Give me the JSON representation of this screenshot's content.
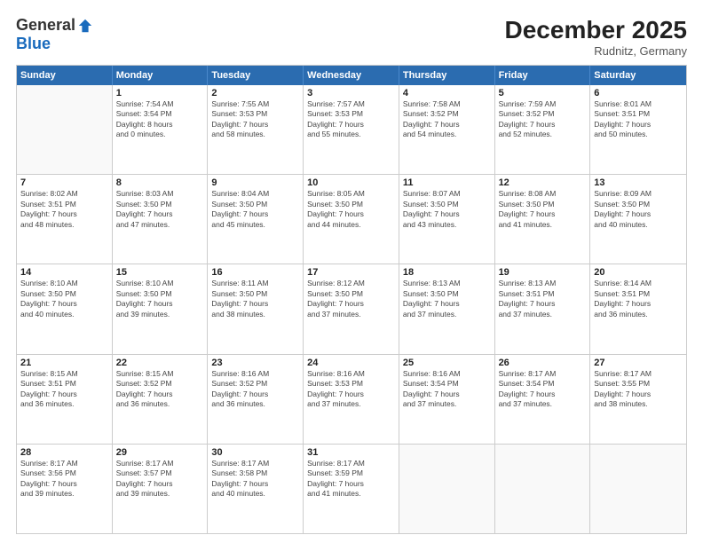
{
  "logo": {
    "general": "General",
    "blue": "Blue"
  },
  "title": "December 2025",
  "subtitle": "Rudnitz, Germany",
  "header_days": [
    "Sunday",
    "Monday",
    "Tuesday",
    "Wednesday",
    "Thursday",
    "Friday",
    "Saturday"
  ],
  "weeks": [
    [
      {
        "day": "",
        "info": ""
      },
      {
        "day": "1",
        "info": "Sunrise: 7:54 AM\nSunset: 3:54 PM\nDaylight: 8 hours\nand 0 minutes."
      },
      {
        "day": "2",
        "info": "Sunrise: 7:55 AM\nSunset: 3:53 PM\nDaylight: 7 hours\nand 58 minutes."
      },
      {
        "day": "3",
        "info": "Sunrise: 7:57 AM\nSunset: 3:53 PM\nDaylight: 7 hours\nand 55 minutes."
      },
      {
        "day": "4",
        "info": "Sunrise: 7:58 AM\nSunset: 3:52 PM\nDaylight: 7 hours\nand 54 minutes."
      },
      {
        "day": "5",
        "info": "Sunrise: 7:59 AM\nSunset: 3:52 PM\nDaylight: 7 hours\nand 52 minutes."
      },
      {
        "day": "6",
        "info": "Sunrise: 8:01 AM\nSunset: 3:51 PM\nDaylight: 7 hours\nand 50 minutes."
      }
    ],
    [
      {
        "day": "7",
        "info": "Sunrise: 8:02 AM\nSunset: 3:51 PM\nDaylight: 7 hours\nand 48 minutes."
      },
      {
        "day": "8",
        "info": "Sunrise: 8:03 AM\nSunset: 3:50 PM\nDaylight: 7 hours\nand 47 minutes."
      },
      {
        "day": "9",
        "info": "Sunrise: 8:04 AM\nSunset: 3:50 PM\nDaylight: 7 hours\nand 45 minutes."
      },
      {
        "day": "10",
        "info": "Sunrise: 8:05 AM\nSunset: 3:50 PM\nDaylight: 7 hours\nand 44 minutes."
      },
      {
        "day": "11",
        "info": "Sunrise: 8:07 AM\nSunset: 3:50 PM\nDaylight: 7 hours\nand 43 minutes."
      },
      {
        "day": "12",
        "info": "Sunrise: 8:08 AM\nSunset: 3:50 PM\nDaylight: 7 hours\nand 41 minutes."
      },
      {
        "day": "13",
        "info": "Sunrise: 8:09 AM\nSunset: 3:50 PM\nDaylight: 7 hours\nand 40 minutes."
      }
    ],
    [
      {
        "day": "14",
        "info": "Sunrise: 8:10 AM\nSunset: 3:50 PM\nDaylight: 7 hours\nand 40 minutes."
      },
      {
        "day": "15",
        "info": "Sunrise: 8:10 AM\nSunset: 3:50 PM\nDaylight: 7 hours\nand 39 minutes."
      },
      {
        "day": "16",
        "info": "Sunrise: 8:11 AM\nSunset: 3:50 PM\nDaylight: 7 hours\nand 38 minutes."
      },
      {
        "day": "17",
        "info": "Sunrise: 8:12 AM\nSunset: 3:50 PM\nDaylight: 7 hours\nand 37 minutes."
      },
      {
        "day": "18",
        "info": "Sunrise: 8:13 AM\nSunset: 3:50 PM\nDaylight: 7 hours\nand 37 minutes."
      },
      {
        "day": "19",
        "info": "Sunrise: 8:13 AM\nSunset: 3:51 PM\nDaylight: 7 hours\nand 37 minutes."
      },
      {
        "day": "20",
        "info": "Sunrise: 8:14 AM\nSunset: 3:51 PM\nDaylight: 7 hours\nand 36 minutes."
      }
    ],
    [
      {
        "day": "21",
        "info": "Sunrise: 8:15 AM\nSunset: 3:51 PM\nDaylight: 7 hours\nand 36 minutes."
      },
      {
        "day": "22",
        "info": "Sunrise: 8:15 AM\nSunset: 3:52 PM\nDaylight: 7 hours\nand 36 minutes."
      },
      {
        "day": "23",
        "info": "Sunrise: 8:16 AM\nSunset: 3:52 PM\nDaylight: 7 hours\nand 36 minutes."
      },
      {
        "day": "24",
        "info": "Sunrise: 8:16 AM\nSunset: 3:53 PM\nDaylight: 7 hours\nand 37 minutes."
      },
      {
        "day": "25",
        "info": "Sunrise: 8:16 AM\nSunset: 3:54 PM\nDaylight: 7 hours\nand 37 minutes."
      },
      {
        "day": "26",
        "info": "Sunrise: 8:17 AM\nSunset: 3:54 PM\nDaylight: 7 hours\nand 37 minutes."
      },
      {
        "day": "27",
        "info": "Sunrise: 8:17 AM\nSunset: 3:55 PM\nDaylight: 7 hours\nand 38 minutes."
      }
    ],
    [
      {
        "day": "28",
        "info": "Sunrise: 8:17 AM\nSunset: 3:56 PM\nDaylight: 7 hours\nand 39 minutes."
      },
      {
        "day": "29",
        "info": "Sunrise: 8:17 AM\nSunset: 3:57 PM\nDaylight: 7 hours\nand 39 minutes."
      },
      {
        "day": "30",
        "info": "Sunrise: 8:17 AM\nSunset: 3:58 PM\nDaylight: 7 hours\nand 40 minutes."
      },
      {
        "day": "31",
        "info": "Sunrise: 8:17 AM\nSunset: 3:59 PM\nDaylight: 7 hours\nand 41 minutes."
      },
      {
        "day": "",
        "info": ""
      },
      {
        "day": "",
        "info": ""
      },
      {
        "day": "",
        "info": ""
      }
    ]
  ]
}
